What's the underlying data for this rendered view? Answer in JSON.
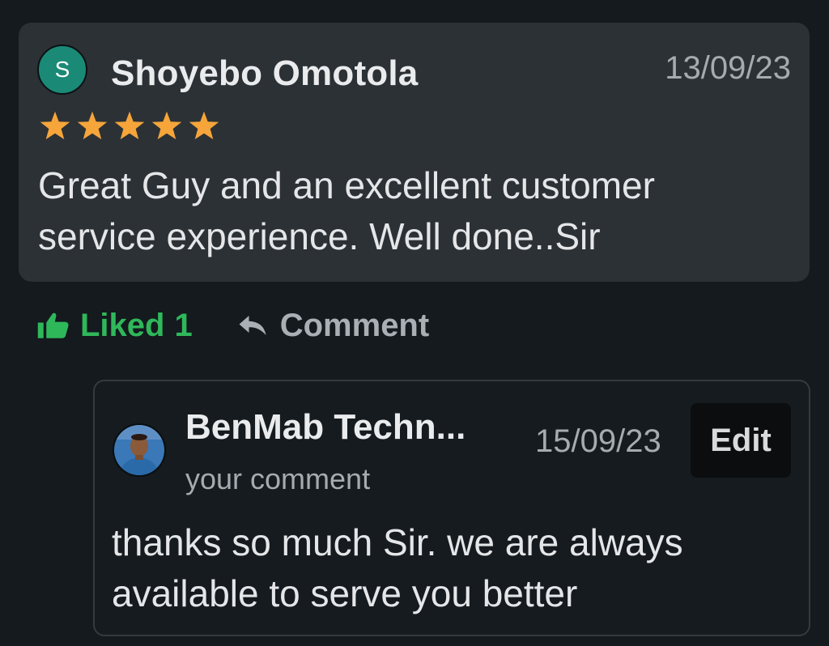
{
  "review": {
    "avatar_letter": "S",
    "name": "Shoyebo Omotola",
    "date": "13/09/23",
    "rating": 5,
    "text": "Great Guy and an excellent customer service experience. Well done..Sir"
  },
  "actions": {
    "like_label": "Liked",
    "like_count": "1",
    "comment_label": "Comment"
  },
  "reply": {
    "name": "BenMab Techn...",
    "date": "15/09/23",
    "edit_label": "Edit",
    "subtitle": "your comment",
    "text": "thanks so much Sir. we are always available to serve you better"
  },
  "colors": {
    "accent_green": "#2fb85a",
    "star_orange": "#f5a53a",
    "avatar_teal": "#1a8a76"
  }
}
